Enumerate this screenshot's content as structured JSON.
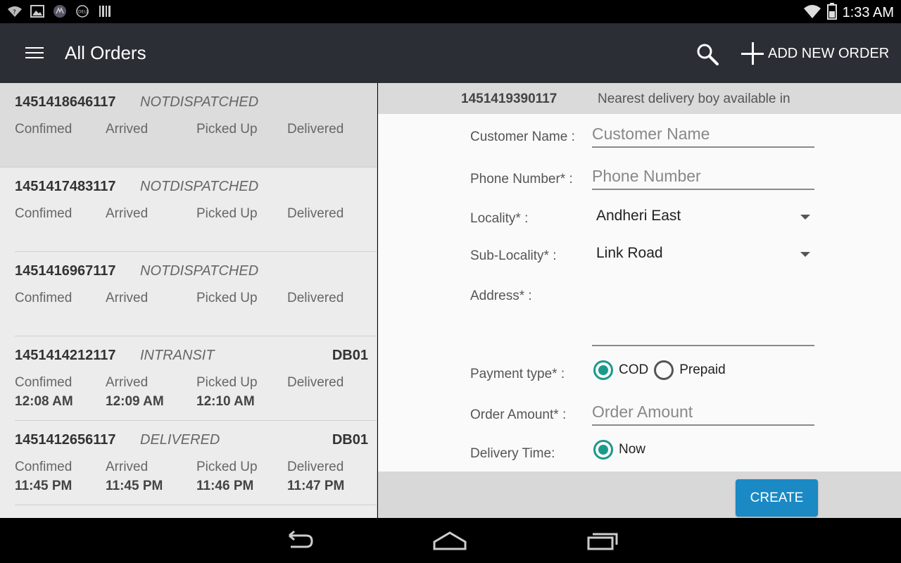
{
  "status_bar": {
    "time": "1:33 AM",
    "icons": [
      "wifi-question-icon",
      "image-icon",
      "app-icon",
      "dell-icon",
      "barcode-icon",
      "wifi-icon",
      "battery-icon"
    ]
  },
  "app_bar": {
    "title": "All Orders",
    "add_order_label": "ADD NEW ORDER"
  },
  "orders": [
    {
      "id": "1451418646117",
      "status": "NOTDISPATCHED",
      "db": "",
      "selected": true,
      "stages": [
        "Confimed",
        "Arrived",
        "Picked Up",
        "Delivered"
      ],
      "times": [
        "",
        "",
        "",
        ""
      ]
    },
    {
      "id": "1451417483117",
      "status": "NOTDISPATCHED",
      "db": "",
      "stages": [
        "Confimed",
        "Arrived",
        "Picked Up",
        "Delivered"
      ],
      "times": [
        "",
        "",
        "",
        ""
      ]
    },
    {
      "id": "1451416967117",
      "status": "NOTDISPATCHED",
      "db": "",
      "stages": [
        "Confimed",
        "Arrived",
        "Picked Up",
        "Delivered"
      ],
      "times": [
        "",
        "",
        "",
        ""
      ]
    },
    {
      "id": "1451414212117",
      "status": "INTRANSIT",
      "db": "DB01",
      "stages": [
        "Confimed",
        "Arrived",
        "Picked Up",
        "Delivered"
      ],
      "times": [
        "12:08 AM",
        "12:09 AM",
        "12:10 AM",
        ""
      ]
    },
    {
      "id": "1451412656117",
      "status": "DELIVERED",
      "db": "DB01",
      "stages": [
        "Confimed",
        "Arrived",
        "Picked Up",
        "Delivered"
      ],
      "times": [
        "11:45 PM",
        "11:45 PM",
        "11:46 PM",
        "11:47 PM"
      ]
    }
  ],
  "detail": {
    "order_id": "1451419390117",
    "message": "Nearest delivery boy available in",
    "form": {
      "customer_name_label": "Customer Name :",
      "customer_name_placeholder": "Customer Name",
      "customer_name_value": "",
      "phone_label": "Phone Number* :",
      "phone_placeholder": "Phone Number",
      "phone_value": "",
      "locality_label": "Locality* :",
      "locality_value": "Andheri East",
      "sublocality_label": "Sub-Locality* :",
      "sublocality_value": "Link Road",
      "address_label": "Address* :",
      "address_value": "",
      "payment_label": "Payment type*  :",
      "payment_options": [
        "COD",
        "Prepaid"
      ],
      "payment_selected": "COD",
      "amount_label": "Order Amount* :",
      "amount_placeholder": "Order Amount",
      "amount_value": "",
      "delivery_label": "Delivery Time:",
      "delivery_option": "Now"
    },
    "create_label": "CREATE"
  },
  "colors": {
    "app_bar": "#2b2e35",
    "accent_radio": "#1b9a8a",
    "create_button": "#1a89c4"
  }
}
